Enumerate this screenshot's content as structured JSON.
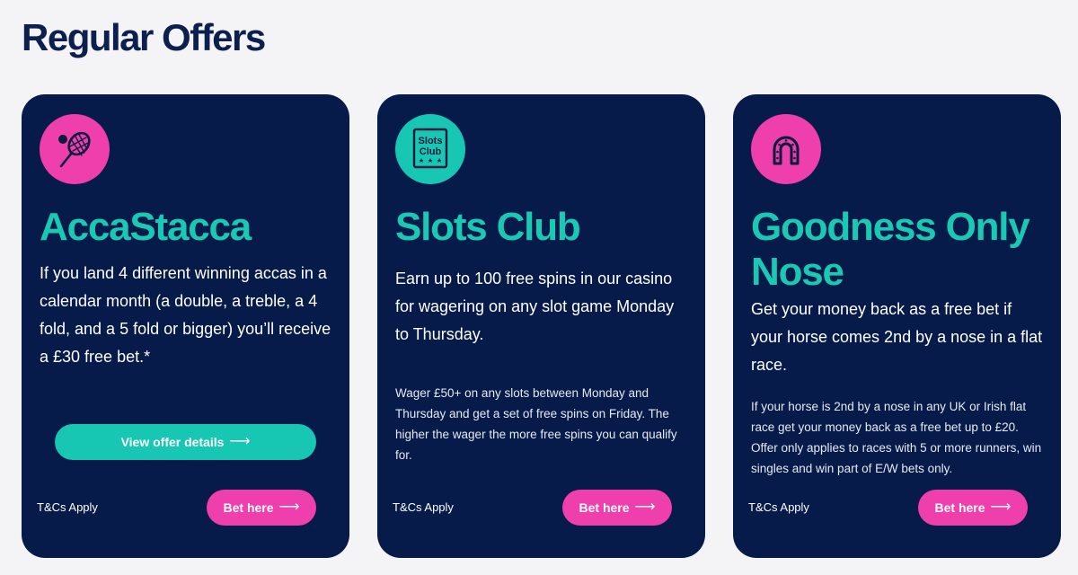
{
  "page": {
    "title": "Regular Offers"
  },
  "cards": [
    {
      "icon": "tennis-racket-icon",
      "title": "AccaStacca",
      "lead": "If you land 4 different winning accas in a calendar month (a double, a treble, a 4 fold, and a 5 fold or bigger) you’ll receive a £30 free bet.*",
      "details_label": "View offer details",
      "tcs": "T&Cs Apply",
      "bet_label": "Bet here"
    },
    {
      "icon": "slots-club-icon",
      "icon_text_1": "Slots",
      "icon_text_2": "Club",
      "title": "Slots Club",
      "lead": "Earn up to 100 free spins in our casino for wagering on any slot game Monday to Thursday.",
      "small": "Wager £50+ on any slots between Monday and Thursday and get a set of free spins on Friday. The higher the wager the more free spins you can qualify for.",
      "tcs": "T&Cs Apply",
      "bet_label": "Bet here"
    },
    {
      "icon": "horseshoe-icon",
      "title": "Goodness Only Nose",
      "lead": "Get your money back as a free bet if your horse comes 2nd by a nose in a flat race.",
      "small": "If your horse is 2nd by a nose in any UK or Irish flat race get your money back as a free bet up to £20. Offer only applies to races with 5 or more runners, win singles and win part of E/W bets only.",
      "tcs": "T&Cs Apply",
      "bet_label": "Bet here"
    }
  ],
  "colors": {
    "navy": "#061b49",
    "teal": "#17c7b3",
    "pink": "#ee3fad",
    "title": "#0c1f4f"
  }
}
